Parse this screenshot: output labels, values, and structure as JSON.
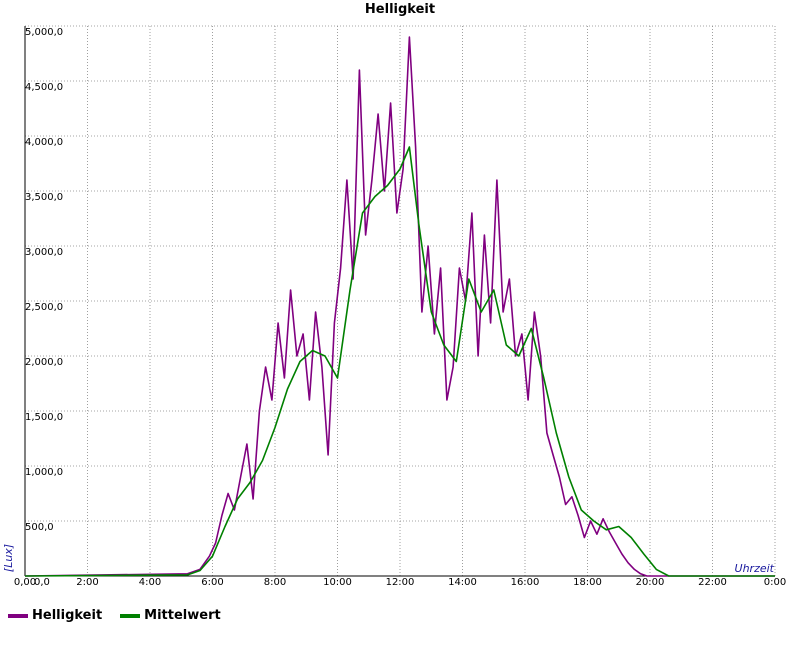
{
  "chart_data": {
    "type": "line",
    "title": "Helligkeit",
    "xlabel": "Uhrzeit",
    "ylabel": "[Lux]",
    "xlim": [
      0,
      24
    ],
    "ylim": [
      0,
      5000
    ],
    "x_ticks": [
      "0,00",
      "2:00",
      "4:00",
      "6:00",
      "8:00",
      "10:00",
      "12:00",
      "14:00",
      "16:00",
      "18:00",
      "20:00",
      "22:00",
      "0:00"
    ],
    "y_ticks": [
      "0,0",
      "500,0",
      "1,000,0",
      "1,500,0",
      "2,000,0",
      "2,500,0",
      "3,000,0",
      "3,500,0",
      "4,000,0",
      "4,500,0",
      "5,000,0"
    ],
    "grid": true,
    "legend": "bottom-left",
    "colors": {
      "Helligkeit": "#800080",
      "Mittelwert": "#008000"
    },
    "series": [
      {
        "name": "Helligkeit",
        "x": [
          0,
          5.2,
          5.6,
          5.9,
          6.1,
          6.3,
          6.5,
          6.7,
          6.9,
          7.1,
          7.3,
          7.5,
          7.7,
          7.9,
          8.1,
          8.3,
          8.5,
          8.7,
          8.9,
          9.1,
          9.3,
          9.5,
          9.7,
          9.9,
          10.1,
          10.3,
          10.5,
          10.7,
          10.9,
          11.1,
          11.3,
          11.5,
          11.7,
          11.9,
          12.1,
          12.3,
          12.5,
          12.7,
          12.9,
          13.1,
          13.3,
          13.5,
          13.7,
          13.9,
          14.1,
          14.3,
          14.5,
          14.7,
          14.9,
          15.1,
          15.3,
          15.5,
          15.7,
          15.9,
          16.1,
          16.3,
          16.5,
          16.7,
          16.9,
          17.1,
          17.3,
          17.5,
          17.7,
          17.9,
          18.1,
          18.3,
          18.5,
          18.7,
          18.9,
          19.1,
          19.3,
          19.5,
          19.7,
          19.9,
          20.1,
          20.3,
          24
        ],
        "y": [
          0,
          20,
          60,
          180,
          300,
          550,
          750,
          600,
          900,
          1200,
          700,
          1500,
          1900,
          1600,
          2300,
          1800,
          2600,
          2000,
          2200,
          1600,
          2400,
          1900,
          1100,
          2300,
          2800,
          3600,
          2700,
          4600,
          3100,
          3600,
          4200,
          3500,
          4300,
          3300,
          3700,
          4900,
          3900,
          2400,
          3000,
          2200,
          2800,
          1600,
          1900,
          2800,
          2500,
          3300,
          2000,
          3100,
          2300,
          3600,
          2400,
          2700,
          2000,
          2200,
          1600,
          2400,
          2000,
          1300,
          1100,
          900,
          650,
          720,
          550,
          350,
          500,
          380,
          520,
          400,
          300,
          200,
          120,
          60,
          20,
          0,
          0,
          0,
          0
        ]
      },
      {
        "name": "Mittelwert",
        "x": [
          0,
          5.2,
          5.6,
          6.0,
          6.4,
          6.8,
          7.2,
          7.6,
          8.0,
          8.4,
          8.8,
          9.2,
          9.6,
          10.0,
          10.4,
          10.8,
          11.2,
          11.6,
          12.0,
          12.3,
          12.6,
          13.0,
          13.4,
          13.8,
          14.2,
          14.6,
          15.0,
          15.4,
          15.8,
          16.2,
          16.6,
          17.0,
          17.4,
          17.8,
          18.2,
          18.6,
          19.0,
          19.4,
          19.8,
          20.2,
          20.6,
          24
        ],
        "y": [
          0,
          10,
          50,
          180,
          450,
          700,
          850,
          1050,
          1350,
          1700,
          1950,
          2050,
          2000,
          1800,
          2600,
          3300,
          3450,
          3550,
          3700,
          3900,
          3200,
          2400,
          2100,
          1950,
          2700,
          2400,
          2600,
          2100,
          2000,
          2250,
          1800,
          1300,
          900,
          600,
          500,
          420,
          450,
          350,
          200,
          60,
          0,
          0
        ]
      }
    ]
  }
}
